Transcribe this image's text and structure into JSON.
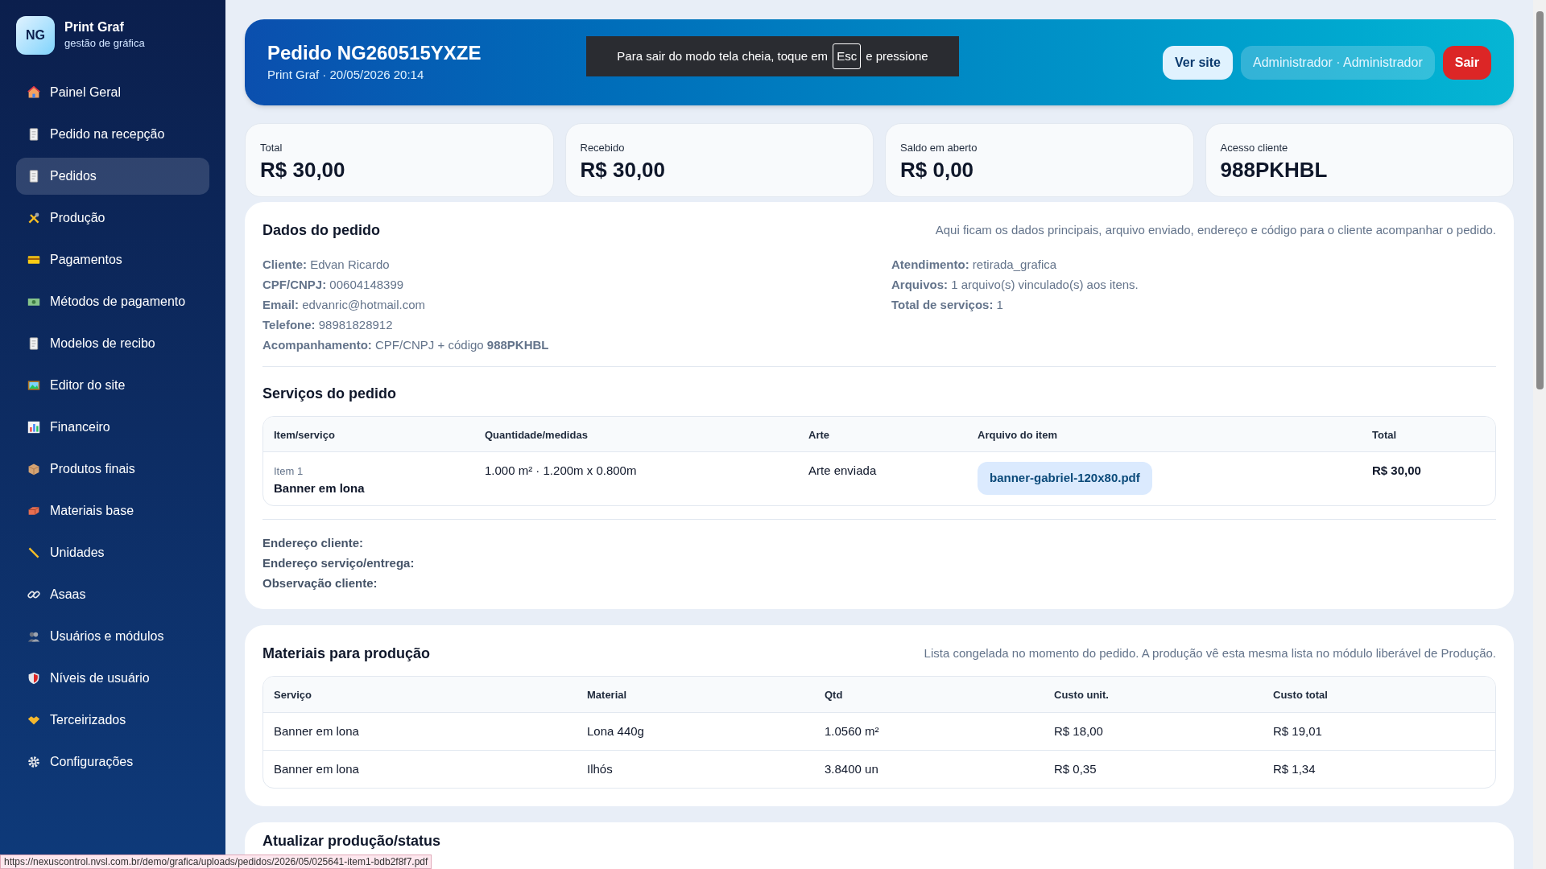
{
  "sidebar": {
    "logo": "NG",
    "brand": "Print Graf",
    "tagline": "gestão de gráfica",
    "items": [
      {
        "label": "Painel Geral",
        "selected": false
      },
      {
        "label": "Pedido na recepção",
        "selected": false
      },
      {
        "label": "Pedidos",
        "selected": true
      },
      {
        "label": "Produção",
        "selected": false
      },
      {
        "label": "Pagamentos",
        "selected": false
      },
      {
        "label": "Métodos de pagamento",
        "selected": false
      },
      {
        "label": "Modelos de recibo",
        "selected": false
      },
      {
        "label": "Editor do site",
        "selected": false
      },
      {
        "label": "Financeiro",
        "selected": false
      },
      {
        "label": "Produtos finais",
        "selected": false
      },
      {
        "label": "Materiais base",
        "selected": false
      },
      {
        "label": "Unidades",
        "selected": false
      },
      {
        "label": "Asaas",
        "selected": false
      },
      {
        "label": "Usuários e módulos",
        "selected": false
      },
      {
        "label": "Níveis de usuário",
        "selected": false
      },
      {
        "label": "Terceirizados",
        "selected": false
      },
      {
        "label": "Configurações",
        "selected": false
      }
    ]
  },
  "header": {
    "title": "Pedido NG260515YXZE",
    "subtitle": "Print Graf · 20/05/2026 20:14",
    "buttons": [
      {
        "label": "Ver site",
        "kind": "light"
      },
      {
        "label": "Administrador · Administrador",
        "kind": "user"
      },
      {
        "label": "Sair",
        "kind": "danger"
      }
    ]
  },
  "fullscreen_notice": {
    "before": "Para sair do modo tela cheia, toque em",
    "key": "Esc",
    "after": "e pressione"
  },
  "stats": [
    {
      "label": "Total",
      "value": "R$ 30,00"
    },
    {
      "label": "Recebido",
      "value": "R$ 30,00"
    },
    {
      "label": "Saldo em aberto",
      "value": "R$ 0,00"
    },
    {
      "label": "Acesso cliente",
      "value": "988PKHBL"
    }
  ],
  "order_details": {
    "title": "Dados do pedido",
    "description": "Aqui ficam os dados principais, arquivo enviado, endereço e código para o cliente acompanhar o pedido.",
    "left_fields": [
      "**Cliente:** Edvan Ricardo",
      "**CPF/CNPJ:** 00604148399",
      "**Email:** edvanric@hotmail.com",
      "**Telefone:** 98981828912",
      "**Acompanhamento:** CPF/CNPJ + código **988PKHBL**"
    ],
    "right_fields": [
      "**Atendimento:** retirada_grafica",
      "**Arquivos:** 1 arquivo(s) vinculado(s) aos itens.",
      "**Total de serviços:** 1"
    ],
    "services_title": "Serviços do pedido",
    "services_columns": [
      "Item/serviço",
      "Quantidade/medidas",
      "Arte",
      "Arquivo do item",
      "Total"
    ],
    "services_rows": [
      {
        "item_number": "Item 1",
        "service": "Banner em lona",
        "quantity": "1.000 m² · 1.200m x 0.800m",
        "art": "Arte enviada",
        "file": "banner-gabriel-120x80.pdf",
        "total": "R$ 30,00"
      }
    ],
    "address_fields": [
      "Endereço cliente:",
      "Endereço serviço/entrega:",
      "Observação cliente:"
    ]
  },
  "materials": {
    "title": "Materiais para produção",
    "description": "Lista congelada no momento do pedido. A produção vê esta mesma lista no módulo liberável de Produção.",
    "columns": [
      "Serviço",
      "Material",
      "Qtd",
      "Custo unit.",
      "Custo total"
    ],
    "rows": [
      [
        "Banner em lona",
        "Lona 440g",
        "1.0560 m²",
        "R$ 18,00",
        "R$ 19,01"
      ],
      [
        "Banner em lona",
        "Ilhós",
        "3.8400 un",
        "R$ 0,35",
        "R$ 1,34"
      ]
    ]
  },
  "status_section": {
    "title": "Atualizar produção/status"
  },
  "status_bar": {
    "url": "https://nexuscontrol.nvsl.com.br/demo/grafica/uploads/pedidos/2026/05/025641-item1-bdb2f8f7.pdf"
  }
}
